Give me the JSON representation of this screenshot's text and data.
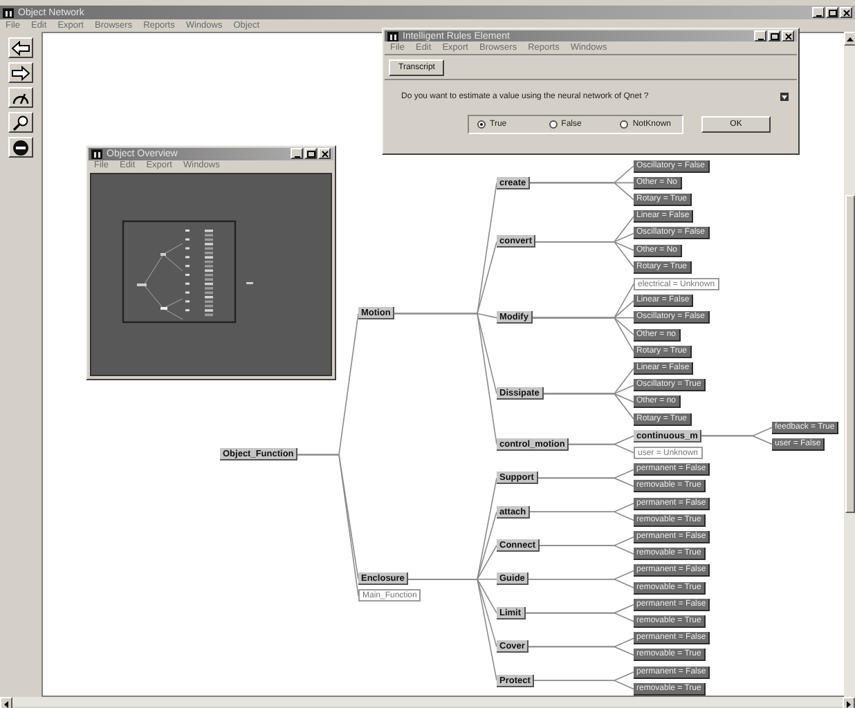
{
  "main_window": {
    "title": "Object Network",
    "menu": [
      "File",
      "Edit",
      "Export",
      "Browsers",
      "Reports",
      "Windows",
      "Object"
    ]
  },
  "tree": {
    "label": "Object_Function",
    "kind": "concept",
    "children": [
      {
        "label": "Motion",
        "kind": "concept",
        "children": [
          {
            "label": "create",
            "kind": "concept",
            "children": [
              {
                "label": "Oscillatory = False",
                "kind": "value"
              },
              {
                "label": "Other = No",
                "kind": "value"
              },
              {
                "label": "Rotary = True",
                "kind": "value"
              }
            ]
          },
          {
            "label": "convert",
            "kind": "concept",
            "children": [
              {
                "label": "Linear = False",
                "kind": "value"
              },
              {
                "label": "Oscillatory = False",
                "kind": "value"
              },
              {
                "label": "Other = No",
                "kind": "value"
              },
              {
                "label": "Rotary = True",
                "kind": "value"
              }
            ]
          },
          {
            "label": "Modify",
            "kind": "concept",
            "children": [
              {
                "label": "electrical = Unknown",
                "kind": "unset"
              },
              {
                "label": "Linear = False",
                "kind": "value"
              },
              {
                "label": "Oscillatory = False",
                "kind": "value"
              },
              {
                "label": "Other = no",
                "kind": "value"
              },
              {
                "label": "Rotary = True",
                "kind": "value"
              }
            ]
          },
          {
            "label": "Dissipate",
            "kind": "concept",
            "children": [
              {
                "label": "Linear = False",
                "kind": "value"
              },
              {
                "label": "Oscillatory = True",
                "kind": "value"
              },
              {
                "label": "Other = no",
                "kind": "value"
              },
              {
                "label": "Rotary = True",
                "kind": "value"
              }
            ]
          },
          {
            "label": "control_motion",
            "kind": "concept",
            "children": [
              {
                "label": "continuous_m",
                "kind": "concept",
                "children": [
                  {
                    "label": "feedback = True",
                    "kind": "value"
                  },
                  {
                    "label": "user = False",
                    "kind": "value"
                  }
                ]
              },
              {
                "label": "user = Unknown",
                "kind": "unset"
              }
            ]
          }
        ]
      },
      {
        "label": "Enclosure",
        "kind": "concept",
        "children": [
          {
            "label": "Support",
            "kind": "concept",
            "children": [
              {
                "label": "permanent = False",
                "kind": "value"
              },
              {
                "label": "removable = True",
                "kind": "value"
              }
            ]
          },
          {
            "label": "attach",
            "kind": "concept",
            "children": [
              {
                "label": "permanent = False",
                "kind": "value"
              },
              {
                "label": "removable = True",
                "kind": "value"
              }
            ]
          },
          {
            "label": "Connect",
            "kind": "concept",
            "children": [
              {
                "label": "permanent = False",
                "kind": "value"
              },
              {
                "label": "removable = True",
                "kind": "value"
              }
            ]
          },
          {
            "label": "Guide",
            "kind": "concept",
            "children": [
              {
                "label": "permanent = False",
                "kind": "value"
              },
              {
                "label": "removable = True",
                "kind": "value"
              }
            ]
          },
          {
            "label": "Limit",
            "kind": "concept",
            "children": [
              {
                "label": "permanent = False",
                "kind": "value"
              },
              {
                "label": "removable = True",
                "kind": "value"
              }
            ]
          },
          {
            "label": "Cover",
            "kind": "concept",
            "children": [
              {
                "label": "permanent = False",
                "kind": "value"
              },
              {
                "label": "removable = True",
                "kind": "value"
              }
            ]
          },
          {
            "label": "Protect",
            "kind": "concept",
            "children": [
              {
                "label": "permanent = False",
                "kind": "value"
              },
              {
                "label": "removable = True",
                "kind": "value"
              }
            ]
          }
        ]
      },
      {
        "label": "Main_Function",
        "kind": "unset"
      }
    ]
  },
  "overview_window": {
    "title": "Object Overview",
    "menu": [
      "File",
      "Edit",
      "Export",
      "Windows"
    ]
  },
  "dialog": {
    "title": "Intelligent Rules Element",
    "menu": [
      "File",
      "Edit",
      "Export",
      "Browsers",
      "Reports",
      "Windows"
    ],
    "toolbar_button": "Transcript",
    "question": "Do you want to estimate a value using the neural network of Qnet ?",
    "options": [
      {
        "label": "True",
        "selected": true
      },
      {
        "label": "False",
        "selected": false
      },
      {
        "label": "NotKnown",
        "selected": false
      }
    ],
    "ok_button": "OK"
  }
}
